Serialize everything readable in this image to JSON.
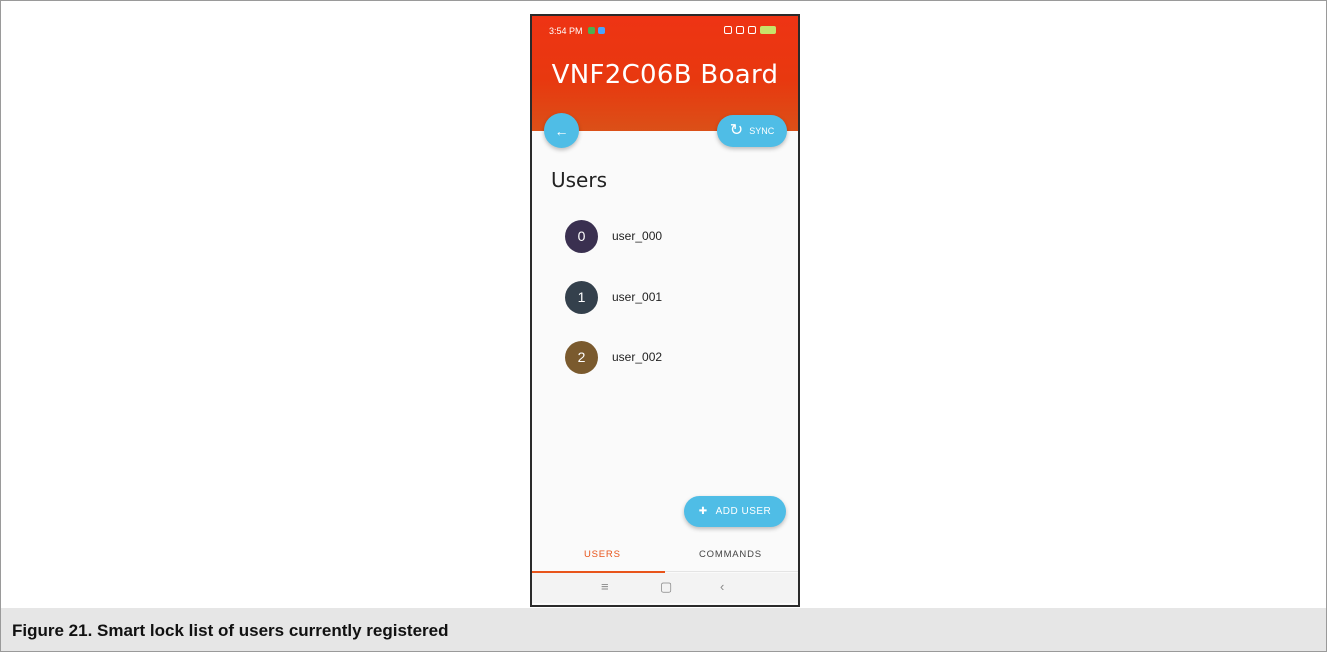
{
  "status_bar": {
    "time": "3:54 PM"
  },
  "app": {
    "title": "VNF2C06B Board"
  },
  "toolbar": {
    "back_icon": "arrow-left-icon",
    "sync_label": "SYNC",
    "sync_icon": "refresh-icon"
  },
  "users_section": {
    "title": "Users",
    "items": [
      {
        "index": "0",
        "name": "user_000",
        "color": "#3a3050"
      },
      {
        "index": "1",
        "name": "user_001",
        "color": "#34404c"
      },
      {
        "index": "2",
        "name": "user_002",
        "color": "#7a5a2e"
      }
    ]
  },
  "add_user": {
    "label": "ADD USER",
    "icon": "add-person-icon"
  },
  "tabs": [
    {
      "label": "USERS",
      "active": true
    },
    {
      "label": "COMMANDS",
      "active": false
    }
  ],
  "nav_icons": [
    "menu-icon",
    "home-square-icon",
    "back-chevron-icon"
  ],
  "caption": "Figure 21.  Smart lock list of users currently registered",
  "colors": {
    "header": "#ee3414",
    "fab": "#4fbde6",
    "accent": "#e8541a"
  }
}
